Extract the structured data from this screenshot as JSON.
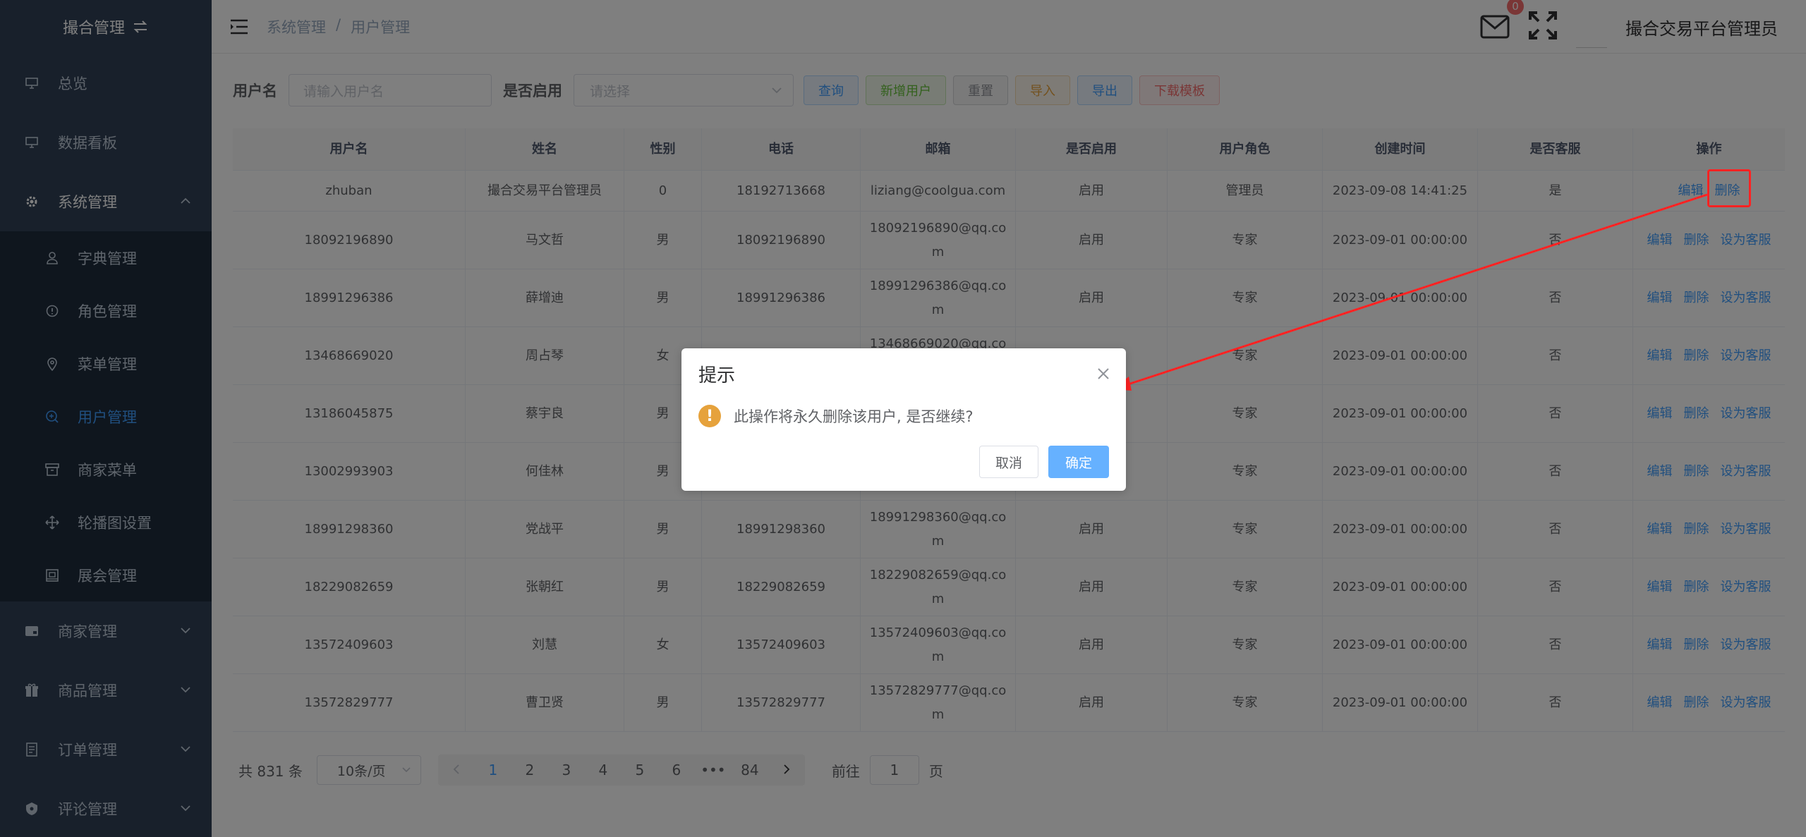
{
  "sidebar": {
    "title": "撮合管理",
    "items": [
      {
        "label": "总览",
        "icon": "monitor-icon"
      },
      {
        "label": "数据看板",
        "icon": "monitor-icon"
      },
      {
        "label": "系统管理",
        "icon": "gear-icon"
      }
    ],
    "subitems": [
      {
        "label": "字典管理",
        "icon": "user-icon"
      },
      {
        "label": "角色管理",
        "icon": "info-icon"
      },
      {
        "label": "菜单管理",
        "icon": "location-icon"
      },
      {
        "label": "用户管理",
        "icon": "search-circle-icon"
      },
      {
        "label": "商家菜单",
        "icon": "box-icon"
      },
      {
        "label": "轮播图设置",
        "icon": "move-icon"
      },
      {
        "label": "展会管理",
        "icon": "picture-icon"
      }
    ],
    "bottom_items": [
      {
        "label": "商家管理",
        "icon": "card-icon"
      },
      {
        "label": "商品管理",
        "icon": "gift-icon"
      },
      {
        "label": "订单管理",
        "icon": "document-icon"
      },
      {
        "label": "评论管理",
        "icon": "shield-icon"
      }
    ]
  },
  "header": {
    "breadcrumb": [
      "系统管理",
      "/",
      "用户管理"
    ],
    "badge_count": "0",
    "admin_name": "撮合交易平台管理员"
  },
  "filter": {
    "username_label": "用户名",
    "username_placeholder": "请输入用户名",
    "enabled_label": "是否启用",
    "enabled_placeholder": "请选择",
    "buttons": [
      "查询",
      "新增用户",
      "重置",
      "导入",
      "导出",
      "下载模板"
    ]
  },
  "table": {
    "headers": [
      "用户名",
      "姓名",
      "性别",
      "电话",
      "邮箱",
      "是否启用",
      "用户角色",
      "创建时间",
      "是否客服",
      "操作"
    ],
    "actions": {
      "edit": "编辑",
      "delete": "删除",
      "set_cs": "设为客服"
    },
    "rows": [
      [
        "zhuban",
        "撮合交易平台管理员",
        "0",
        "18192713668",
        "liziang@coolgua.com",
        "启用",
        "管理员",
        "2023-09-08 14:41:25",
        "是"
      ],
      [
        "18092196890",
        "马文哲",
        "男",
        "18092196890",
        "18092196890@qq.com",
        "启用",
        "专家",
        "2023-09-01 00:00:00",
        "否"
      ],
      [
        "18991296386",
        "薛增迪",
        "男",
        "18991296386",
        "18991296386@qq.com",
        "启用",
        "专家",
        "2023-09-01 00:00:00",
        "否"
      ],
      [
        "13468669020",
        "周占琴",
        "女",
        "",
        "13468669020@qq.com",
        "",
        "专家",
        "2023-09-01 00:00:00",
        "否"
      ],
      [
        "13186045875",
        "蔡宇良",
        "男",
        "",
        "",
        "",
        "专家",
        "2023-09-01 00:00:00",
        "否"
      ],
      [
        "13002993903",
        "何佳林",
        "男",
        "",
        "",
        "",
        "专家",
        "2023-09-01 00:00:00",
        "否"
      ],
      [
        "18991298360",
        "党战平",
        "男",
        "18991298360",
        "18991298360@qq.com",
        "启用",
        "专家",
        "2023-09-01 00:00:00",
        "否"
      ],
      [
        "18229082659",
        "张朝红",
        "男",
        "18229082659",
        "18229082659@qq.com",
        "启用",
        "专家",
        "2023-09-01 00:00:00",
        "否"
      ],
      [
        "13572409603",
        "刘慧",
        "女",
        "13572409603",
        "13572409603@qq.com",
        "启用",
        "专家",
        "2023-09-01 00:00:00",
        "否"
      ],
      [
        "13572829777",
        "曹卫贤",
        "男",
        "13572829777",
        "13572829777@qq.com",
        "启用",
        "专家",
        "2023-09-01 00:00:00",
        "否"
      ]
    ]
  },
  "pagination": {
    "total": "共 831 条",
    "page_size": "10条/页",
    "pages": [
      "1",
      "2",
      "3",
      "4",
      "5",
      "6",
      "•••",
      "84"
    ],
    "goto_label": "前往",
    "goto_value": "1",
    "goto_suffix": "页"
  },
  "dialog": {
    "title": "提示",
    "message": "此操作将永久删除该用户, 是否继续?",
    "cancel": "取消",
    "confirm": "确定"
  },
  "colors": {
    "sidebar_bg": "#304156",
    "primary": "#409eff",
    "warning": "#e6a23c",
    "annotation": "#ff2222"
  }
}
